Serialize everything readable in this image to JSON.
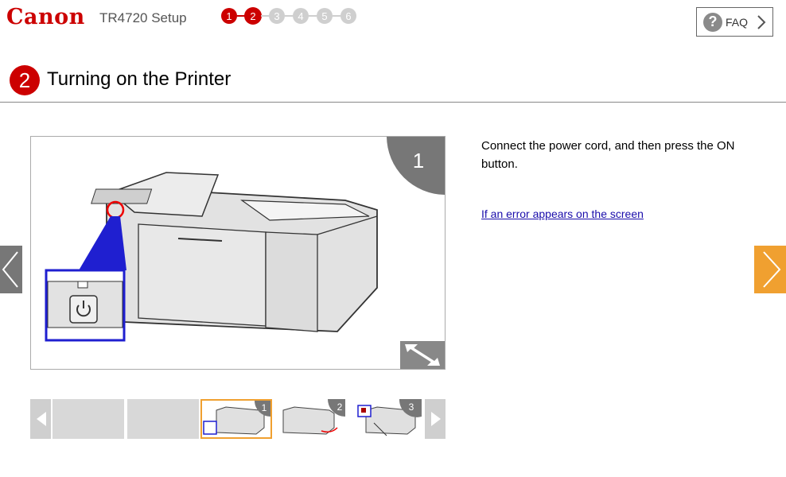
{
  "header": {
    "brand": "Canon",
    "app_title": "TR4720 Setup",
    "steps": [
      "1",
      "2",
      "3",
      "4",
      "5",
      "6"
    ],
    "current_step": 2,
    "faq_label": "FAQ",
    "faq_icon": "?"
  },
  "page": {
    "step_number": "2",
    "title": "Turning on the Printer"
  },
  "viewer": {
    "slide_number": "1",
    "instruction": "Connect the power cord, and then press the ON button.",
    "error_link": "If an error appears on the screen",
    "icons": {
      "expand": "expand-arrows-icon",
      "prev": "chevron-left-icon",
      "next": "chevron-right-icon"
    }
  },
  "thumbnails": [
    {
      "number": "1",
      "selected": true
    },
    {
      "number": "2",
      "selected": false
    },
    {
      "number": "3",
      "selected": false
    }
  ],
  "colors": {
    "brand_red": "#cc0000",
    "accent_orange": "#f0a030",
    "inactive_gray": "#cfcfcf"
  }
}
